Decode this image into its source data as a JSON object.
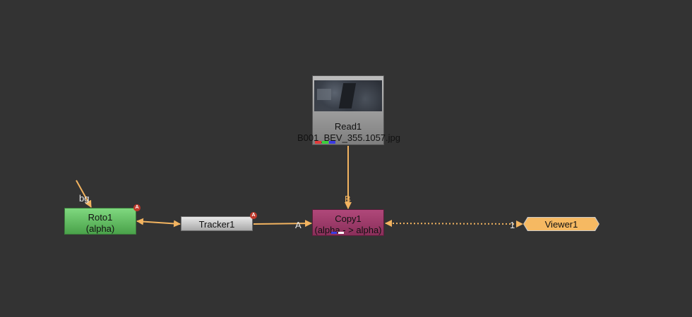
{
  "nodes": {
    "read": {
      "title": "Read1",
      "subtitle": "B001_BEV_355.1057.jpg",
      "channel_colors": [
        "#e23b3b",
        "#3bd13b",
        "#3b3be2"
      ]
    },
    "roto": {
      "title": "Roto1",
      "subtitle": "(alpha)",
      "badge": "A",
      "input_label": "bg"
    },
    "tracker": {
      "title": "Tracker1",
      "badge": "A"
    },
    "copy": {
      "title": "Copy1",
      "subtitle": "(alpha - > alpha)",
      "input_a_label": "A",
      "input_b_label": "B"
    },
    "viewer": {
      "title": "Viewer1",
      "input_label": "1"
    }
  },
  "colors": {
    "background": "#333333",
    "pipe": "#f3b460",
    "roto": "#5cb85c",
    "copy": "#9c3b68",
    "viewer": "#f6b962"
  }
}
